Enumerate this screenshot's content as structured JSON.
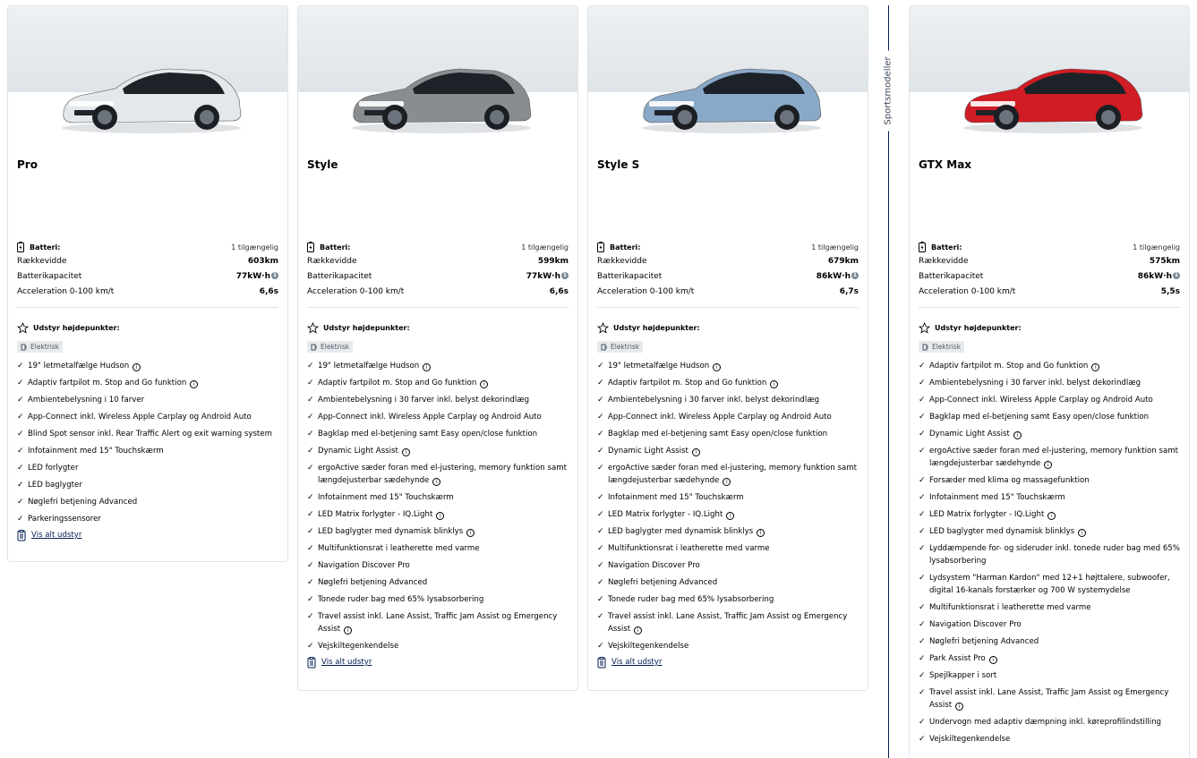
{
  "section_label": "Sportsmodeller",
  "specs_labels": {
    "battery": "Batteri:",
    "range": "Rækkevidde",
    "capacity": "Batterikapacitet",
    "accel": "Acceleration 0-100 km/t",
    "highlights": "Udstyr højdepunkter:",
    "electric": "Elektrisk",
    "see_all": "Vis alt udstyr"
  },
  "cards": [
    {
      "name": "Pro",
      "car_color": "#e5e8ea",
      "available": "1 tilgængelig",
      "range": "603km",
      "capacity": "77kW·h",
      "accel": "6,6s",
      "items": [
        {
          "text": "19\" letmetalfælge Hudson",
          "info": true
        },
        {
          "text": "Adaptiv fartpilot m. Stop and Go funktion",
          "info": true
        },
        {
          "text": "Ambientebelysning i 10 farver",
          "info": false
        },
        {
          "text": "App-Connect inkl. Wireless Apple Carplay og Android Auto",
          "info": false
        },
        {
          "text": "Blind Spot sensor inkl. Rear Traffic Alert og exit warning system",
          "info": false
        },
        {
          "text": "Infotainment med 15\" Touchskærm",
          "info": false
        },
        {
          "text": "LED forlygter",
          "info": false
        },
        {
          "text": "LED baglygter",
          "info": false
        },
        {
          "text": "Nøglefri betjening Advanced",
          "info": false
        },
        {
          "text": "Parkeringssensorer",
          "info": false
        }
      ]
    },
    {
      "name": "Style",
      "car_color": "#8a8d90",
      "available": "1 tilgængelig",
      "range": "599km",
      "capacity": "77kW·h",
      "accel": "6,6s",
      "items": [
        {
          "text": "19\" letmetalfælge Hudson",
          "info": true
        },
        {
          "text": "Adaptiv fartpilot m. Stop and Go funktion",
          "info": true
        },
        {
          "text": "Ambientebelysning i 30 farver inkl. belyst dekorindlæg",
          "info": false
        },
        {
          "text": "App-Connect inkl. Wireless Apple Carplay og Android Auto",
          "info": false
        },
        {
          "text": "Bagklap med el-betjening samt Easy open/close funktion",
          "info": false
        },
        {
          "text": "Dynamic Light Assist",
          "info": true
        },
        {
          "text": "ergoActive sæder foran med el-justering, memory funktion samt længdejusterbar sædehynde",
          "info": true
        },
        {
          "text": "Infotainment med 15\" Touchskærm",
          "info": false
        },
        {
          "text": "LED Matrix forlygter - IQ.Light",
          "info": true
        },
        {
          "text": "LED baglygter med dynamisk blinklys",
          "info": true
        },
        {
          "text": "Multifunktionsrat i leatherette med varme",
          "info": false
        },
        {
          "text": "Navigation Discover Pro",
          "info": false
        },
        {
          "text": "Nøglefri betjening Advanced",
          "info": false
        },
        {
          "text": "Tonede ruder bag med 65% lysabsorbering",
          "info": false
        },
        {
          "text": "Travel assist inkl. Lane Assist, Traffic Jam Assist og Emergency Assist",
          "info": true
        },
        {
          "text": "Vejskiltegenkendelse",
          "info": false
        }
      ]
    },
    {
      "name": "Style S",
      "car_color": "#8aa8c8",
      "available": "1 tilgængelig",
      "range": "679km",
      "capacity": "86kW·h",
      "accel": "6,7s",
      "items": [
        {
          "text": "19\" letmetalfælge Hudson",
          "info": true
        },
        {
          "text": "Adaptiv fartpilot m. Stop and Go funktion",
          "info": true
        },
        {
          "text": "Ambientebelysning i 30 farver inkl. belyst dekorindlæg",
          "info": false
        },
        {
          "text": "App-Connect inkl. Wireless Apple Carplay og Android Auto",
          "info": false
        },
        {
          "text": "Bagklap med el-betjening samt Easy open/close funktion",
          "info": false
        },
        {
          "text": "Dynamic Light Assist",
          "info": true
        },
        {
          "text": "ergoActive sæder foran med el-justering, memory funktion samt længdejusterbar sædehynde",
          "info": true
        },
        {
          "text": "Infotainment med 15\" Touchskærm",
          "info": false
        },
        {
          "text": "LED Matrix forlygter - IQ.Light",
          "info": true
        },
        {
          "text": "LED baglygter med dynamisk blinklys",
          "info": true
        },
        {
          "text": "Multifunktionsrat i leatherette med varme",
          "info": false
        },
        {
          "text": "Navigation Discover Pro",
          "info": false
        },
        {
          "text": "Nøglefri betjening Advanced",
          "info": false
        },
        {
          "text": "Tonede ruder bag med 65% lysabsorbering",
          "info": false
        },
        {
          "text": "Travel assist inkl. Lane Assist, Traffic Jam Assist og Emergency Assist",
          "info": true
        },
        {
          "text": "Vejskiltegenkendelse",
          "info": false
        }
      ]
    },
    {
      "name": "GTX Max",
      "car_color": "#d01c24",
      "available": "1 tilgængelig",
      "range": "575km",
      "capacity": "86kW·h",
      "accel": "5,5s",
      "items": [
        {
          "text": "Adaptiv fartpilot m. Stop and Go funktion",
          "info": true
        },
        {
          "text": "Ambientebelysning i 30 farver inkl. belyst dekorindlæg",
          "info": false
        },
        {
          "text": "App-Connect inkl. Wireless Apple Carplay og Android Auto",
          "info": false
        },
        {
          "text": "Bagklap med el-betjening samt Easy open/close funktion",
          "info": false
        },
        {
          "text": "Dynamic Light Assist",
          "info": true
        },
        {
          "text": "ergoActive sæder foran med el-justering, memory funktion samt længdejusterbar sædehynde",
          "info": true
        },
        {
          "text": "Forsæder med klima og massagefunktion",
          "info": false
        },
        {
          "text": "Infotainment med 15\" Touchskærm",
          "info": false
        },
        {
          "text": "LED Matrix forlygter - IQ.Light",
          "info": true
        },
        {
          "text": "LED baglygter med dynamisk blinklys",
          "info": true
        },
        {
          "text": "Lyddæmpende for- og sideruder inkl. tonede ruder bag med 65% lysabsorbering",
          "info": false
        },
        {
          "text": "Lydsystem \"Harman Kardon\" med 12+1 højttalere, subwoofer, digital 16-kanals forstærker og 700 W systemydelse",
          "info": false
        },
        {
          "text": "Multifunktionsrat i leatherette med varme",
          "info": false
        },
        {
          "text": "Navigation Discover Pro",
          "info": false
        },
        {
          "text": "Nøglefri betjening Advanced",
          "info": false
        },
        {
          "text": "Park Assist Pro",
          "info": true
        },
        {
          "text": "Spejlkapper i sort",
          "info": false
        },
        {
          "text": "Travel assist inkl. Lane Assist, Traffic Jam Assist og Emergency Assist",
          "info": true
        },
        {
          "text": "Undervogn med adaptiv dæmpning inkl. køreprofilindstilling",
          "info": false
        },
        {
          "text": "Vejskiltegenkendelse",
          "info": false
        }
      ]
    }
  ]
}
